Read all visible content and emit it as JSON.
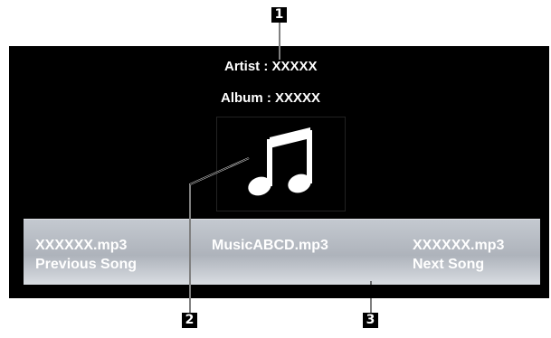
{
  "player": {
    "artist_line": "Artist : XXXXX",
    "album_line": "Album : XXXXX",
    "album_art_icon": "music-note-icon"
  },
  "song_bar": {
    "previous": {
      "file": "XXXXXX.mp3",
      "label": "Previous Song"
    },
    "current": {
      "file": "MusicABCD.mp3"
    },
    "next": {
      "file": "XXXXXX.mp3",
      "label": "Next Song"
    }
  },
  "callouts": {
    "one": "1",
    "two": "2",
    "three": "3"
  },
  "colors": {
    "screen_background": "#000000",
    "text": "#ffffff",
    "song_bar": "#b6bbc3"
  }
}
